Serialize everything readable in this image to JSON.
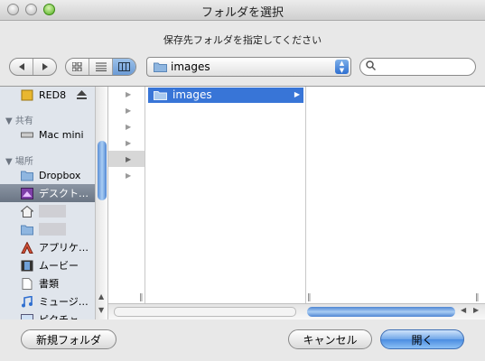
{
  "window": {
    "title": "フォルダを選択",
    "prompt": "保存先フォルダを指定してください"
  },
  "toolbar": {
    "location": "images",
    "search": {
      "placeholder": "",
      "value": ""
    }
  },
  "sidebar": {
    "devices": [
      {
        "label": "RED8",
        "icon": "disk-icon"
      }
    ],
    "shared_header": "共有",
    "shared": [
      {
        "label": "Mac mini",
        "icon": "computer-icon"
      }
    ],
    "places_header": "場所",
    "places": [
      {
        "label": "Dropbox",
        "icon": "folder-icon"
      },
      {
        "label": "デスクト…",
        "icon": "desktop-icon",
        "selected": true
      },
      {
        "label": "",
        "icon": "home-icon"
      },
      {
        "label": "",
        "icon": "folder-icon"
      },
      {
        "label": "アプリケ…",
        "icon": "applications-icon"
      },
      {
        "label": "ムービー",
        "icon": "movies-icon"
      },
      {
        "label": "書類",
        "icon": "documents-icon"
      },
      {
        "label": "ミュージ…",
        "icon": "music-icon"
      },
      {
        "label": "ピクチャ",
        "icon": "pictures-icon"
      }
    ]
  },
  "columns": {
    "col1": [
      {
        "label": "images",
        "selected": true
      }
    ]
  },
  "buttons": {
    "new_folder": "新規フォルダ",
    "cancel": "キャンセル",
    "open": "開く"
  }
}
